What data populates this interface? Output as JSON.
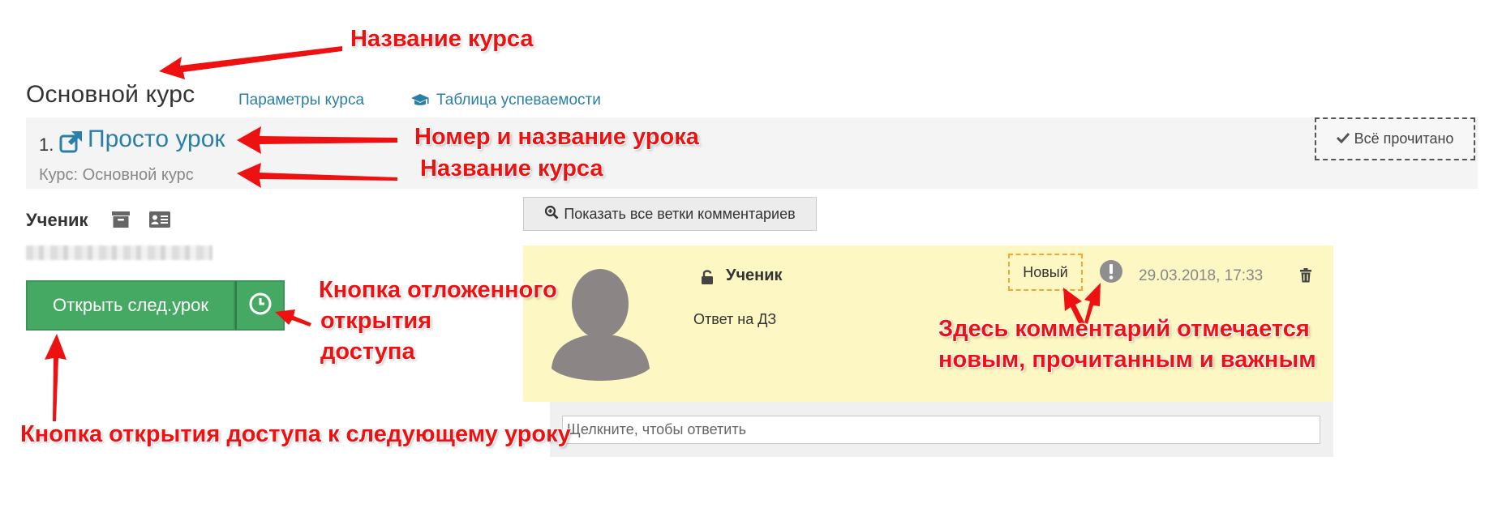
{
  "header": {
    "course_title": "Основной курс",
    "params_link": "Параметры курса",
    "gradebook_link": "Таблица успеваемости"
  },
  "lesson": {
    "number": "1.",
    "name": "Просто урок",
    "course_line": "Курс: Основной курс",
    "read_all_label": "Всё прочитано"
  },
  "student": {
    "label": "Ученик",
    "open_next_label": "Открыть след.урок"
  },
  "comments": {
    "show_threads_label": "Показать все ветки комментариев",
    "author": "Ученик",
    "text": "Ответ на ДЗ",
    "badge": "Новый",
    "timestamp": "29.03.2018, 17:33",
    "reply_placeholder": "Щелкните, чтобы ответить"
  },
  "annotations": {
    "course_title": "Название курса",
    "lesson_number_name": "Номер и название урока",
    "course_name": "Название курса",
    "delay_line1": "Кнопка отложенного",
    "delay_line2": "открытия",
    "delay_line3": "доступа",
    "open_next": "Кнопка открытия доступа к следующему уроку",
    "mark_line1": "Здесь комментарий отмечается",
    "mark_line2": "новым, прочитанным и важным"
  },
  "colors": {
    "link": "#2a7fa6",
    "green_button": "#45a963",
    "comment_bg": "#fdf7c3",
    "annotation_red": "#ee1111",
    "badge_border": "#f0a830"
  },
  "icons": [
    "graduation-cap-icon",
    "external-link-icon",
    "check-icon",
    "archive-icon",
    "id-card-icon",
    "clock-icon",
    "search-plus-icon",
    "lock-open-icon",
    "exclamation-circle-icon",
    "trash-icon",
    "avatar-silhouette"
  ]
}
